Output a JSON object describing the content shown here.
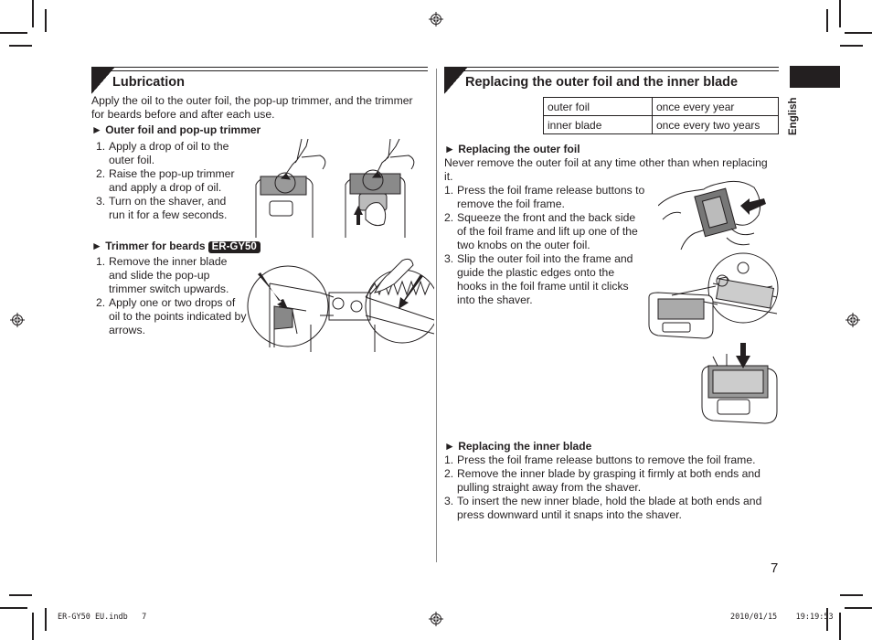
{
  "page": {
    "language_tab": "English",
    "page_number": "7",
    "footer_left": "ER-GY50 EU.indb   7",
    "footer_right": "2010/01/15    19:19:53"
  },
  "lubrication": {
    "title": "Lubrication",
    "intro": "Apply the oil to the outer foil, the pop-up trimmer, and the trimmer for beards before and after each use.",
    "outer_foil": {
      "heading": "► Outer foil and pop-up trimmer",
      "steps": [
        {
          "num": "1.",
          "text": "Apply a drop of oil to the outer foil."
        },
        {
          "num": "2.",
          "text": "Raise the pop-up trimmer and apply a drop of oil."
        },
        {
          "num": "3.",
          "text": "Turn on the shaver, and run it for a few seconds."
        }
      ]
    },
    "beard_trimmer": {
      "heading": "► Trimmer for beards",
      "model_badge": "ER-GY50",
      "steps": [
        {
          "num": "1.",
          "text": "Remove the inner blade and slide the pop-up trimmer switch upwards."
        },
        {
          "num": "2.",
          "text": "Apply one or two drops of oil to the points indicated by arrows."
        }
      ]
    }
  },
  "replacing": {
    "title": "Replacing the outer foil and the inner blade",
    "schedule": [
      {
        "part": "outer foil",
        "interval": "once every year"
      },
      {
        "part": "inner blade",
        "interval": "once every two years"
      }
    ],
    "outer_foil": {
      "heading": "► Replacing the outer foil",
      "note": "Never remove the outer foil at any time other than when replacing it.",
      "steps": [
        {
          "num": "1.",
          "text": "Press the foil frame release buttons to remove the foil frame."
        },
        {
          "num": "2.",
          "text": "Squeeze the front and the back side of the foil frame and lift up one of the two knobs on the outer foil."
        },
        {
          "num": "3.",
          "text": "Slip the outer foil into the frame and guide the plastic edges onto the hooks in the foil frame until it clicks into the shaver."
        }
      ]
    },
    "inner_blade": {
      "heading": "► Replacing the inner blade",
      "steps": [
        {
          "num": "1.",
          "text": "Press the foil frame release buttons to remove the foil frame."
        },
        {
          "num": "2.",
          "text": "Remove the inner blade by grasping it firmly at both ends and pulling straight away from the shaver."
        },
        {
          "num": "3.",
          "text": "To insert the new inner blade, hold the blade at both ends and press downward until it snaps into the shaver."
        }
      ]
    }
  }
}
